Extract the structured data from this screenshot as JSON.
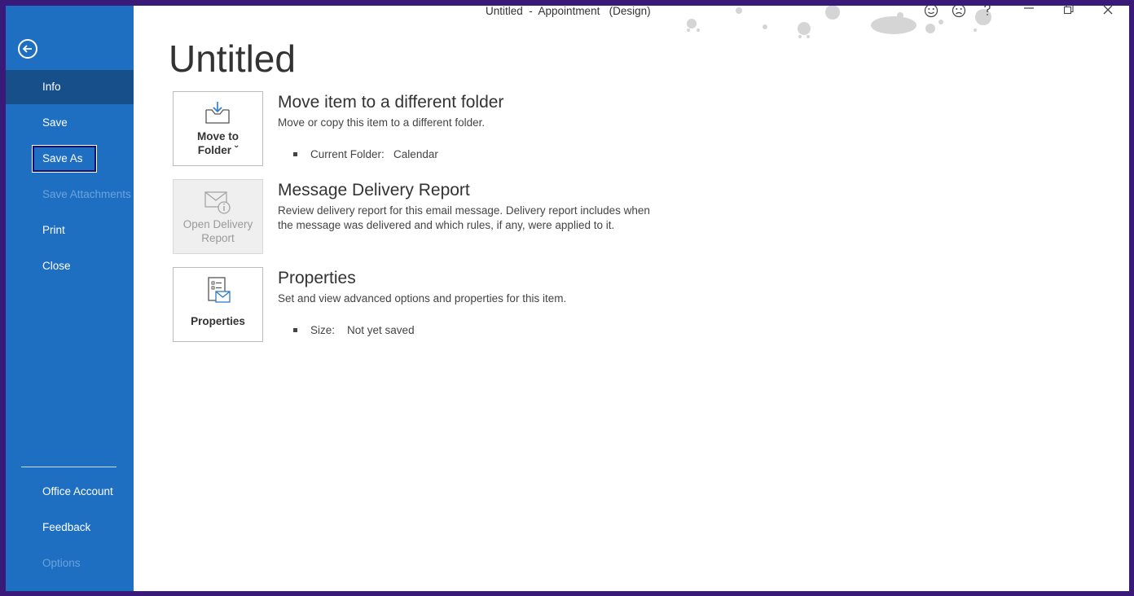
{
  "window": {
    "title": "Untitled  -  Appointment   (Design)"
  },
  "sidebar": {
    "items": [
      {
        "label": "Info"
      },
      {
        "label": "Save"
      },
      {
        "label": "Save As"
      },
      {
        "label": "Save Attachments"
      },
      {
        "label": "Print"
      },
      {
        "label": "Close"
      },
      {
        "label": "Office Account"
      },
      {
        "label": "Feedback"
      },
      {
        "label": "Options"
      }
    ]
  },
  "main": {
    "page_title": "Untitled",
    "sections": [
      {
        "tile_line1": "Move to",
        "tile_line2": "Folder ˇ",
        "title": "Move item to a different folder",
        "desc": "Move or copy this item to a different folder.",
        "bullet": "Current Folder:   Calendar"
      },
      {
        "tile_line1": "Open Delivery",
        "tile_line2": "Report",
        "title": "Message Delivery Report",
        "desc": "Review delivery report for this email message. Delivery report includes when the message was delivered and which rules, if any, were applied to it."
      },
      {
        "tile_line1": "Properties",
        "title": "Properties",
        "desc": "Set and view advanced options and properties for this item.",
        "bullet": "Size:    Not yet saved"
      }
    ]
  },
  "colors": {
    "sidebar": "#1e6fc2",
    "sidebar_active": "#174f8a",
    "frame": "#3a1a78"
  }
}
